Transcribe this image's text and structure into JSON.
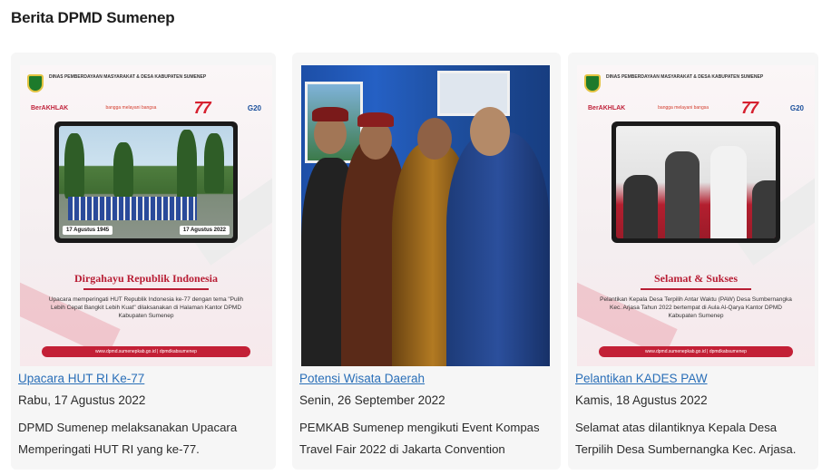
{
  "page": {
    "title": "Berita DPMD Sumenep"
  },
  "colors": {
    "link": "#2a6fb8",
    "accent_red": "#c32036",
    "card_bg": "#f6f6f6"
  },
  "articles": [
    {
      "title": "Upacara HUT RI Ke-77",
      "date": "Rabu, 17 Agustus 2022",
      "desc_line1": "DPMD Sumenep melaksanakan Upacara",
      "desc_line2": "Memperingati HUT RI yang ke-77.",
      "image": {
        "org": "DINAS PEMBERDAYAAN MASYARAKAT & DESA KABUPATEN SUMENEP",
        "logo_berakhlak": "BerAKHLAK",
        "logo_bangga": "bangga melayani bangsa",
        "logo_77": "77",
        "logo_g20": "G20",
        "date_left": "17 Agustus 1945",
        "date_right": "17 Agustus 2022",
        "headline": "Dirgahayu Republik Indonesia",
        "body": "Upacara memperingati HUT Republik Indonesia ke-77 dengan tema \"Pulih Lebih Cepat Bangkit Lebih Kuat\" dilaksanakan di Halaman Kantor DPMD Kabupaten Sumenep",
        "footer": "www.dpmd.sumenepkab.go.id  |  dpmdkabsumenep"
      }
    },
    {
      "title": "Potensi Wisata Daerah",
      "date": "Senin, 26 September 2022",
      "desc_line1": "PEMKAB Sumenep mengikuti Event Kompas",
      "desc_line2": "Travel Fair 2022 di Jakarta Convention",
      "image": {}
    },
    {
      "title": "Pelantikan KADES PAW",
      "date": "Kamis, 18 Agustus 2022",
      "desc_line1": "Selamat atas dilantiknya Kepala Desa",
      "desc_line2": "Terpilih Desa Sumbernangka Kec. Arjasa.",
      "image": {
        "org": "DINAS PEMBERDAYAAN MASYARAKAT & DESA KABUPATEN SUMENEP",
        "logo_berakhlak": "BerAKHLAK",
        "logo_bangga": "bangga melayani bangsa",
        "logo_77": "77",
        "logo_g20": "G20",
        "headline": "Selamat & Sukses",
        "body": "Pelantikan Kepala Desa Terpilih Antar Waktu (PAW) Desa Sumbernangka Kec. Arjasa Tahun 2022 bertempat di Aula Al-Qarya Kantor DPMD Kabupaten Sumenep",
        "footer": "www.dpmd.sumenepkab.go.id  |  dpmdkabsumenep"
      }
    }
  ]
}
